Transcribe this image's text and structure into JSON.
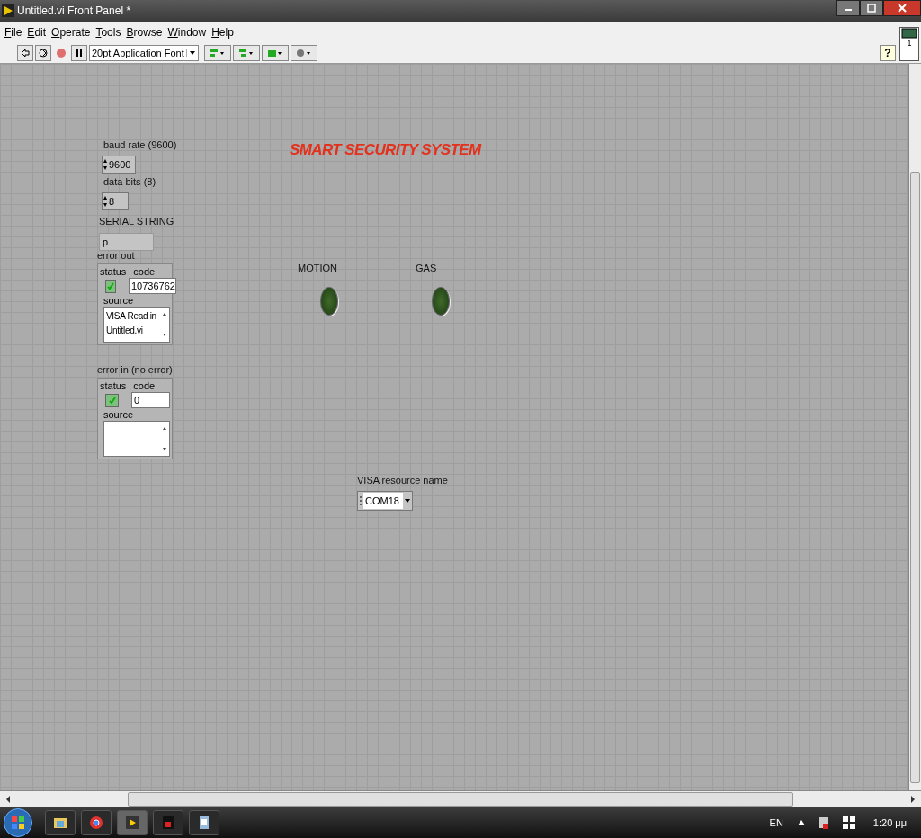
{
  "window": {
    "title": "Untitled.vi Front Panel *"
  },
  "menu": [
    "File",
    "Edit",
    "Operate",
    "Tools",
    "Browse",
    "Window",
    "Help"
  ],
  "toolbar": {
    "font": "20pt Application Font",
    "help": "?"
  },
  "vi_icon": {
    "text": "1"
  },
  "panel": {
    "title": "SMART SECURITY SYSTEM",
    "numerics": [
      {
        "label": "baud rate (9600)",
        "value": "9600"
      },
      {
        "label": "data bits (8)",
        "value": "8"
      }
    ],
    "serial_string": {
      "label": "SERIAL STRING",
      "value": "p"
    },
    "clusters": [
      {
        "label": "error out",
        "status_label": "status",
        "status": true,
        "code_label": "code",
        "code": "10736762",
        "source_label": "source",
        "source": "VISA Read in Untitled.vi"
      },
      {
        "label": "error in (no error)",
        "status_label": "status",
        "status": true,
        "code_label": "code",
        "code": "0",
        "source_label": "source"
      }
    ],
    "leds": [
      {
        "label": "MOTION",
        "on": false
      },
      {
        "label": "GAS",
        "on": false
      }
    ],
    "visa": {
      "label": "VISA resource name",
      "value": "COM18"
    }
  },
  "taskbar": {
    "language": "EN",
    "time": "1:20 μμ"
  }
}
